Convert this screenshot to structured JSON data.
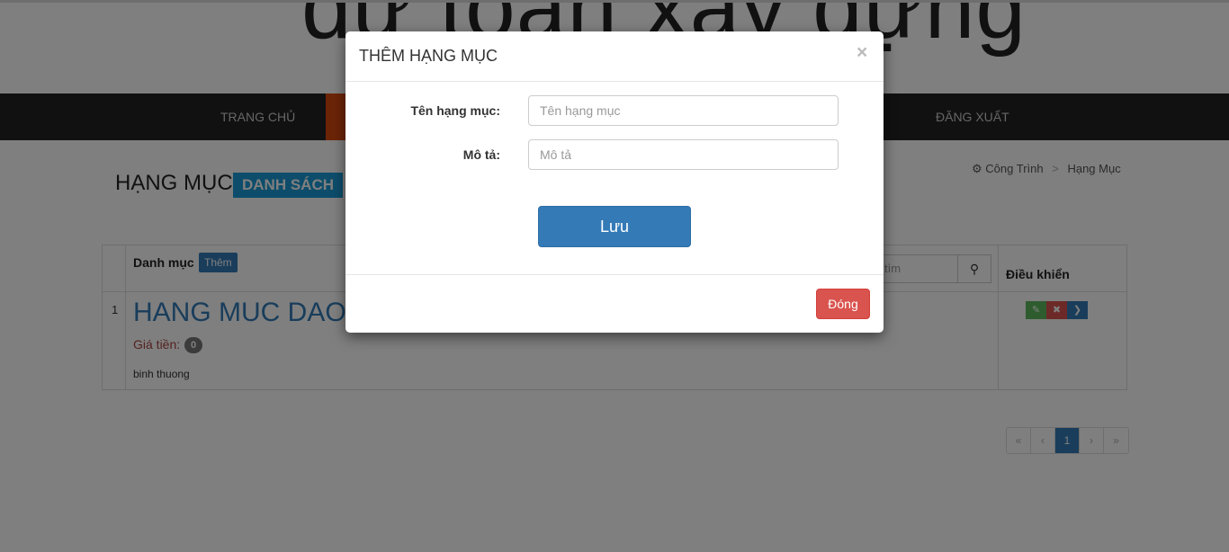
{
  "banner": {
    "text": "dự toán xây dựng"
  },
  "nav": {
    "items": [
      {
        "label": "TRANG CHỦ"
      },
      {
        "label": "ĐĂNG XUẤT"
      }
    ]
  },
  "page": {
    "title": "HẠNG MỤC",
    "title_badge": "DANH SÁCH",
    "breadcrumb": {
      "home": "Công Trình",
      "current": "Hạng Mục"
    }
  },
  "table": {
    "header_category": "Danh mục",
    "add_button": "Thêm",
    "search_placeholder": "tìm",
    "header_controls": "Điều khiển",
    "rows": [
      {
        "index": "1",
        "name": "HANG MUC DAO",
        "price_label": "Giá tiền:",
        "price": "0",
        "description": "binh thuong"
      }
    ]
  },
  "pagination": {
    "first": "«",
    "prev": "‹",
    "current": "1",
    "next": "›",
    "last": "»"
  },
  "modal": {
    "title": "THÊM HẠNG MỤC",
    "close_symbol": "×",
    "fields": {
      "name": {
        "label": "Tên hạng mục:",
        "placeholder": "Tên hạng mục",
        "value": ""
      },
      "description": {
        "label": "Mô tả:",
        "placeholder": "Mô tả",
        "value": ""
      }
    },
    "save_label": "Lưu",
    "close_label": "Đóng"
  },
  "colors": {
    "primary": "#337ab7",
    "danger": "#d9534f",
    "navbar": "#222222",
    "badge": "#1a9ad6"
  }
}
